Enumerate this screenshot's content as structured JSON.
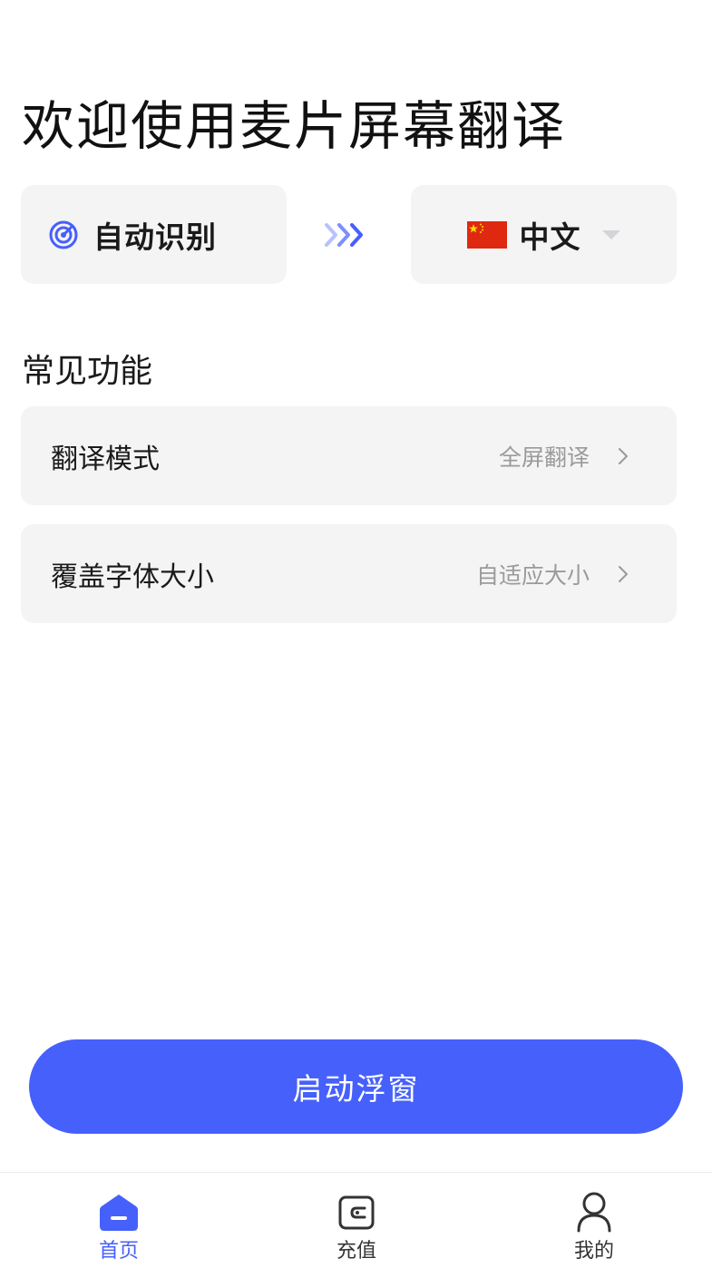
{
  "header": {
    "title": "欢迎使用麦片屏幕翻译"
  },
  "language": {
    "source": {
      "label": "自动识别",
      "icon": "target-radar-icon"
    },
    "swap_icon": "triple-chevron-right-icon",
    "target": {
      "label": "中文",
      "flag_icon": "china-flag-icon",
      "dropdown_icon": "caret-down-icon"
    }
  },
  "features": {
    "section_title": "常见功能",
    "items": [
      {
        "label": "翻译模式",
        "value": "全屏翻译",
        "icon": "chevron-right-icon"
      },
      {
        "label": "覆盖字体大小",
        "value": "自适应大小",
        "icon": "chevron-right-icon"
      }
    ]
  },
  "primary_action": {
    "label": "启动浮窗"
  },
  "tabbar": {
    "items": [
      {
        "label": "首页",
        "icon": "home-icon",
        "active": true
      },
      {
        "label": "充值",
        "icon": "wallet-icon",
        "active": false
      },
      {
        "label": "我的",
        "icon": "user-icon",
        "active": false
      }
    ]
  },
  "colors": {
    "accent": "#4660fb",
    "card_background": "#f4f4f5",
    "secondary_text": "#9a9a9a",
    "flag_red": "#de2910",
    "flag_yellow": "#ffde00"
  }
}
